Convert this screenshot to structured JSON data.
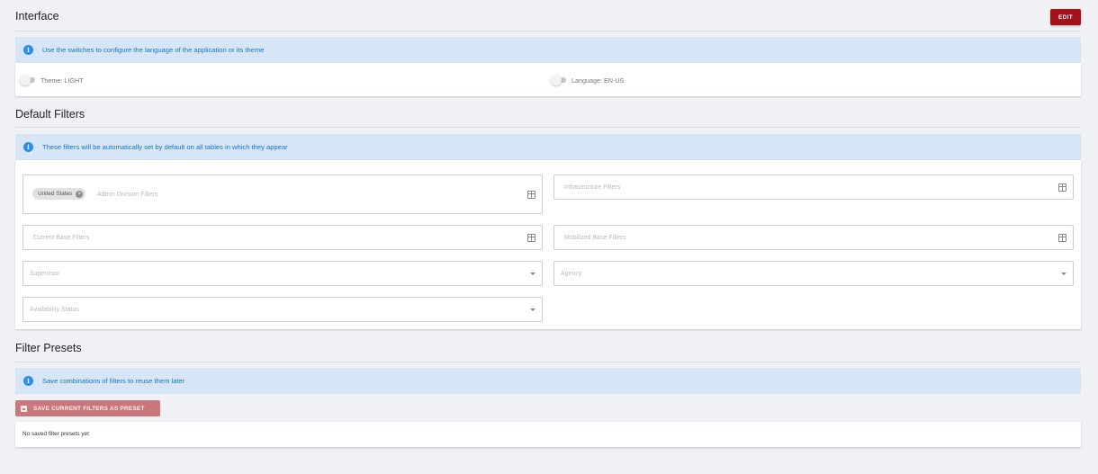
{
  "interface": {
    "title": "Interface",
    "edit_label": "EDIT",
    "info": "Use the switches to configure the language of the application or its theme",
    "theme_toggle": {
      "label": "Theme: LIGHT",
      "on": false
    },
    "language_toggle": {
      "label": "Language: EN-US",
      "on": false
    }
  },
  "default_filters": {
    "title": "Default Filters",
    "info": "These filters will be automatically set by default on all tables in which they appear",
    "admin_division": {
      "placeholder": "Admin Division Filters",
      "chips": [
        "United States"
      ]
    },
    "infrastructure": {
      "placeholder": "Infrastructure Filters"
    },
    "current_base": {
      "placeholder": "Current Base Filters"
    },
    "mobilized_base": {
      "placeholder": "Mobilized Base Filters"
    },
    "supervisor": {
      "placeholder": "Supervisor"
    },
    "agency": {
      "placeholder": "Agency"
    },
    "availability_status": {
      "placeholder": "Availability Status"
    }
  },
  "filter_presets": {
    "title": "Filter Presets",
    "info": "Save combinations of filters to reuse them later",
    "save_button_label": "SAVE CURRENT FILTERS AS PRESET",
    "empty_text": "No saved filter presets yet"
  },
  "icons": {
    "info": "info-icon",
    "grid": "grid-icon",
    "dropdown": "chevron-down-icon",
    "chip_remove": "close-icon",
    "save": "floppy-disk-icon"
  },
  "colors": {
    "primary": "#a3121a",
    "primary_disabled": "#c9777c",
    "info_background": "#d6e6f6",
    "info_text": "#1a73c8"
  }
}
